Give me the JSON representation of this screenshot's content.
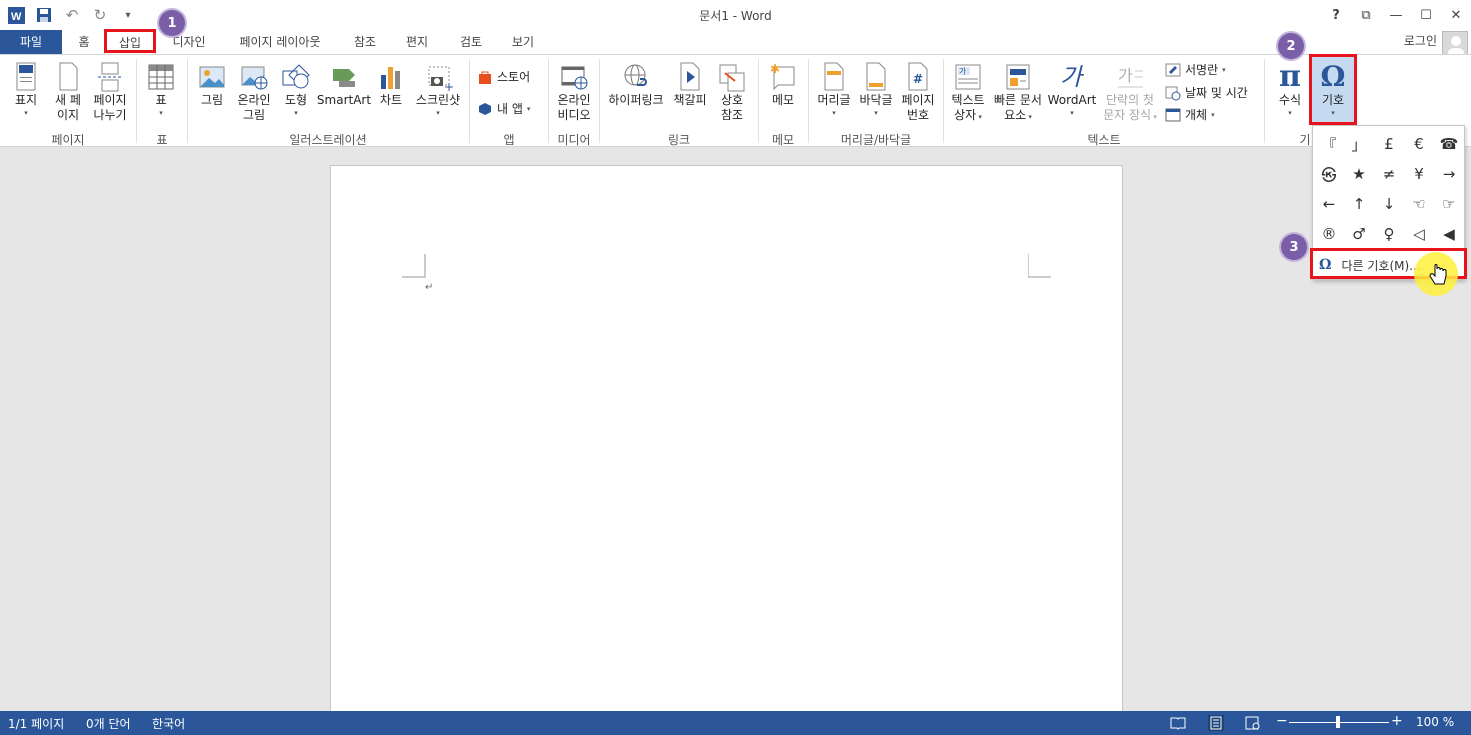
{
  "window": {
    "title": "문서1 - Word",
    "controls": {
      "help": "?",
      "ribbon_display": "⧉",
      "minimize": "—",
      "maximize": "☐",
      "close": "✕"
    }
  },
  "qat": {
    "more": "▾"
  },
  "tabs": {
    "file": "파일",
    "home": "홈",
    "insert": "삽입",
    "design": "디자인",
    "layout": "페이지 레이아웃",
    "references": "참조",
    "mailings": "편지",
    "review": "검토",
    "view": "보기",
    "login": "로그인"
  },
  "ribbon": {
    "pages": {
      "cover": "표지",
      "blank_1": "새 페",
      "blank_2": "이지",
      "break_1": "페이지",
      "break_2": "나누기",
      "group": "페이지"
    },
    "tables": {
      "table": "표",
      "group": "표"
    },
    "illustrations": {
      "picture": "그림",
      "online_1": "온라인",
      "online_2": "그림",
      "shapes": "도형",
      "smartart": "SmartArt",
      "chart": "차트",
      "screenshot": "스크린샷",
      "group": "일러스트레이션"
    },
    "apps": {
      "store": "스토어",
      "myapps": "내 앱",
      "group": "앱"
    },
    "media": {
      "video_1": "온라인",
      "video_2": "비디오",
      "group": "미디어"
    },
    "links": {
      "hyperlink": "하이퍼링크",
      "bookmark": "책갈피",
      "xref_1": "상호",
      "xref_2": "참조",
      "group": "링크"
    },
    "comments": {
      "comment": "메모",
      "group": "메모"
    },
    "headerfooter": {
      "header": "머리글",
      "footer": "바닥글",
      "pagenum_1": "페이지",
      "pagenum_2": "번호",
      "group": "머리글/바닥글"
    },
    "text": {
      "textbox_1": "텍스트",
      "textbox_2": "상자",
      "quickparts_1": "빠른 문서",
      "quickparts_2": "요소",
      "wordart": "WordArt",
      "dropcap_1": "단락의 첫",
      "dropcap_2": "문자 장식",
      "signature": "서명란",
      "datetime": "날짜 및 시간",
      "object": "개체",
      "group": "텍스트"
    },
    "symbols": {
      "equation": "수식",
      "symbol": "기호",
      "group": "기"
    }
  },
  "symbol_menu": {
    "symbols": [
      "『",
      "」",
      "£",
      "€",
      "☎",
      "㉿",
      "★",
      "≠",
      "¥",
      "→",
      "←",
      "↑",
      "↓",
      "☜",
      "☞",
      "®",
      "♂",
      "♀",
      "◁",
      "◀"
    ],
    "more_label": "다른 기호(M)..."
  },
  "document": {
    "paragraph_mark": "↵"
  },
  "statusbar": {
    "page": "1/1 페이지",
    "words": "0개 단어",
    "language": "한국어",
    "zoom": "100 %",
    "zoom_minus": "−",
    "zoom_plus": "+"
  },
  "callouts": [
    "1",
    "2",
    "3"
  ],
  "colors": {
    "accent": "#2b579a",
    "highlight": "#e8141b",
    "badge": "#7b5ea8"
  }
}
